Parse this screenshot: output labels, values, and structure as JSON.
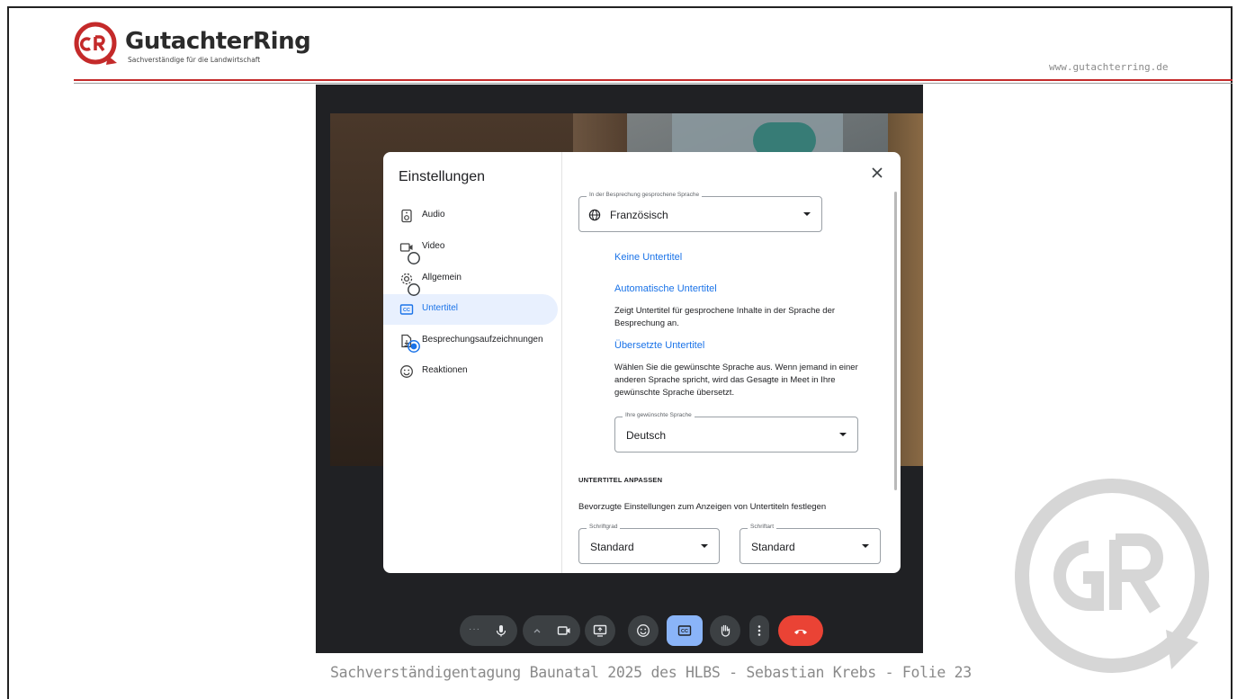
{
  "header": {
    "logo_title": "GutachterRing",
    "logo_subtitle": "Sachverständige für die Landwirtschaft",
    "url": "www.gutachterring.de",
    "brand_red": "#c42a2a"
  },
  "footer": {
    "text": "Sachverständigentagung Baunatal 2025 des HLBS  -  Sebastian Krebs  -  Folie 23"
  },
  "dialog": {
    "title": "Einstellungen",
    "nav": [
      {
        "label": "Audio",
        "icon": "speaker-icon"
      },
      {
        "label": "Video",
        "icon": "videocam-icon"
      },
      {
        "label": "Allgemein",
        "icon": "gear-icon"
      },
      {
        "label": "Untertitel",
        "icon": "closed-caption-icon",
        "active": true
      },
      {
        "label": "Besprechungsaufzeichnungen",
        "icon": "file-download-icon"
      },
      {
        "label": "Reaktionen",
        "icon": "smiley-icon"
      }
    ],
    "spoken_language": {
      "legend": "In der Besprechung gesprochene Sprache",
      "value": "Französisch"
    },
    "options": [
      {
        "label": "Keine Untertitel",
        "selected": false,
        "desc": ""
      },
      {
        "label": "Automatische Untertitel",
        "selected": false,
        "desc": "Zeigt Untertitel für gesprochene Inhalte in der Sprache der Besprechung an."
      },
      {
        "label": "Übersetzte Untertitel",
        "selected": true,
        "desc": "Wählen Sie die gewünschte Sprache aus. Wenn jemand in einer anderen Sprache spricht, wird das Gesagte in Meet in Ihre gewünschte Sprache übersetzt."
      }
    ],
    "target_language": {
      "legend": "Ihre gewünschte Sprache",
      "value": "Deutsch"
    },
    "customize": {
      "title": "UNTERTITEL ANPASSEN",
      "desc": "Bevorzugte Einstellungen zum Anzeigen von Untertiteln festlegen",
      "font_size": {
        "legend": "Schriftgrad",
        "value": "Standard"
      },
      "font_family": {
        "legend": "Schriftart",
        "value": "Standard"
      }
    }
  },
  "controls": {
    "more_label": "···",
    "accent": "#1a73e8",
    "end_call_color": "#ea4335"
  }
}
